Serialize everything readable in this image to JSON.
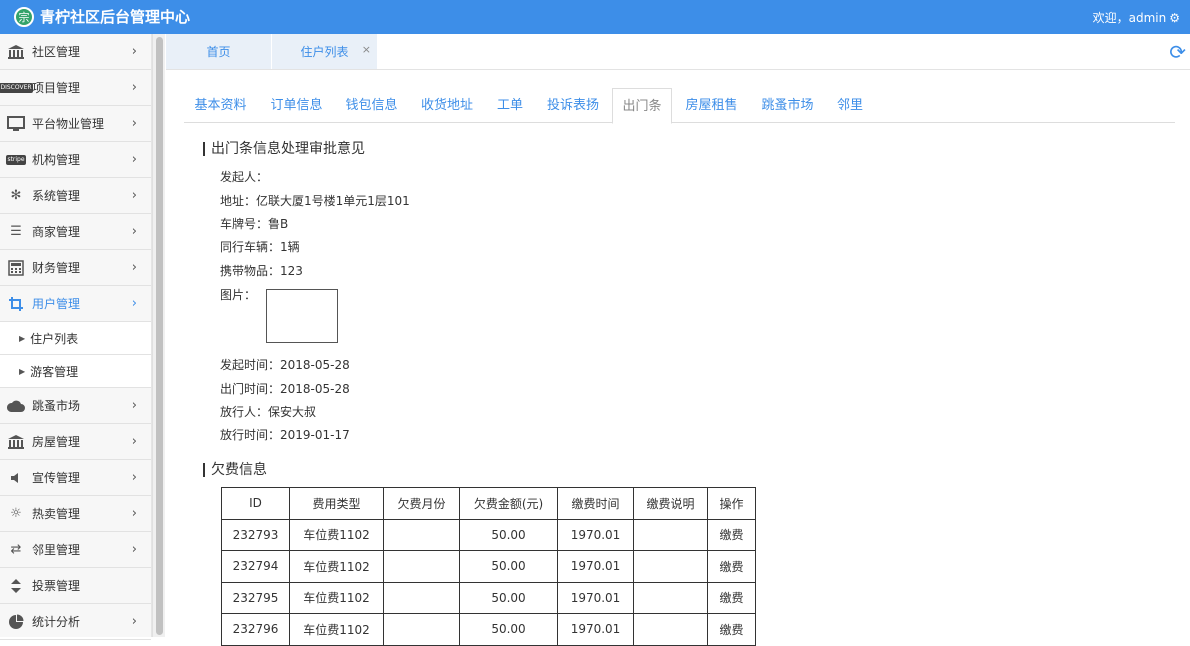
{
  "header": {
    "logo_glyph": "宗",
    "title": "青柠社区后台管理中心",
    "welcome": "欢迎，admin",
    "gear_icon": "⚙"
  },
  "sidebar": {
    "items": [
      {
        "label": "社区管理",
        "icon": "bank-icon"
      },
      {
        "label": "项目管理",
        "icon": "discover-card-icon"
      },
      {
        "label": "平台物业管理",
        "icon": "monitor-icon"
      },
      {
        "label": "机构管理",
        "icon": "stripe-icon"
      },
      {
        "label": "系统管理",
        "icon": "yelp-icon"
      },
      {
        "label": "商家管理",
        "icon": "bars-icon"
      },
      {
        "label": "财务管理",
        "icon": "calculator-icon"
      },
      {
        "label": "用户管理",
        "icon": "crop-icon"
      },
      {
        "label": "跳蚤市场",
        "icon": "cloud-icon"
      },
      {
        "label": "房屋管理",
        "icon": "bank-icon"
      },
      {
        "label": "宣传管理",
        "icon": "volume-icon"
      },
      {
        "label": "热卖管理",
        "icon": "sun-icon"
      },
      {
        "label": "邻里管理",
        "icon": "retweet-icon"
      },
      {
        "label": "投票管理",
        "icon": "sort-icon"
      },
      {
        "label": "统计分析",
        "icon": "pie-chart-icon"
      }
    ],
    "sub_items": [
      {
        "label": "住户列表"
      },
      {
        "label": "游客管理"
      }
    ]
  },
  "page_tabs": [
    {
      "label": "首页"
    },
    {
      "label": "住户列表",
      "close": "×"
    }
  ],
  "sub_tabs": [
    {
      "label": "基本资料"
    },
    {
      "label": "订单信息"
    },
    {
      "label": "钱包信息"
    },
    {
      "label": "收货地址"
    },
    {
      "label": "工单"
    },
    {
      "label": "投诉表扬"
    },
    {
      "label": "出门条"
    },
    {
      "label": "房屋租售"
    },
    {
      "label": "跳蚤市场"
    },
    {
      "label": "邻里"
    }
  ],
  "exit_pass": {
    "title": "出门条信息处理审批意见",
    "initiator": "发起人：",
    "address": "地址：亿联大厦1号楼1单元1层101",
    "plate": "车牌号：鲁B",
    "vehicles": "同行车辆：1辆",
    "items": "携带物品：123",
    "photo_label": "图片：",
    "start_time": "发起时间：2018-05-28",
    "exit_time": "出门时间：2018-05-28",
    "releaser": "放行人：保安大叔",
    "release_time": "放行时间：2019-01-17"
  },
  "arrears": {
    "title": "欠费信息",
    "columns": [
      "ID",
      "费用类型",
      "欠费月份",
      "欠费金额(元)",
      "缴费时间",
      "缴费说明",
      "操作"
    ],
    "rows": [
      [
        "232793",
        "车位费1102",
        "",
        "50.00",
        "1970.01",
        "",
        "缴费"
      ],
      [
        "232794",
        "车位费1102",
        "",
        "50.00",
        "1970.01",
        "",
        "缴费"
      ],
      [
        "232795",
        "车位费1102",
        "",
        "50.00",
        "1970.01",
        "",
        "缴费"
      ],
      [
        "232796",
        "车位费1102",
        "",
        "50.00",
        "1970.01",
        "",
        "缴费"
      ]
    ]
  },
  "colors": {
    "accent": "#3d8ee8",
    "logo_green": "#34a36a"
  }
}
